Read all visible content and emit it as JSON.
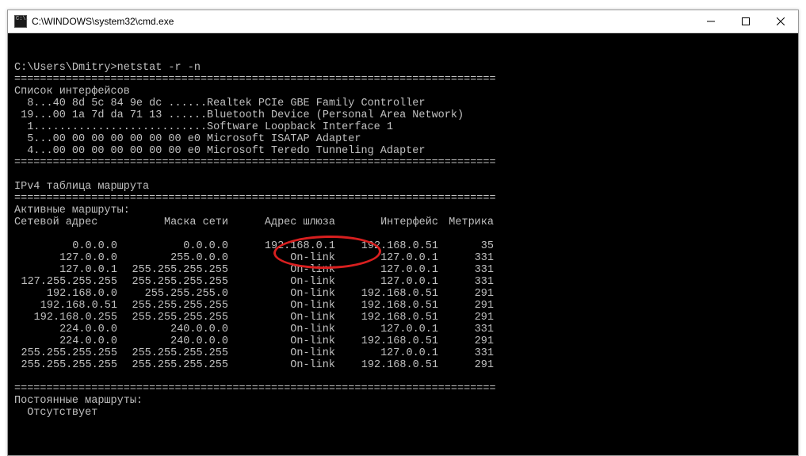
{
  "window": {
    "title": "C:\\WINDOWS\\system32\\cmd.exe",
    "icon_glyph": "C:\\."
  },
  "prompt": {
    "cwd": "C:\\Users\\Dmitry>",
    "command": "netstat -r -n"
  },
  "sections": {
    "if_header": "Список интерфейсов",
    "ipv4_header": "IPv4 таблица маршрута",
    "active_header": "Активные маршруты:",
    "col_net": "Сетевой адрес",
    "col_mask": "Маска сети",
    "col_gw": "Адрес шлюза",
    "col_if": "Интерфейс",
    "col_metric": "Метрика",
    "persist_header": "Постоянные маршруты:",
    "persist_none": "Отсутствует"
  },
  "interfaces": [
    "  8...40 8d 5c 84 9e dc ......Realtek PCIe GBE Family Controller",
    " 19...00 1a 7d da 71 13 ......Bluetooth Device (Personal Area Network)",
    "  1...........................Software Loopback Interface 1",
    "  5...00 00 00 00 00 00 00 e0 Microsoft ISATAP Adapter",
    "  4...00 00 00 00 00 00 00 e0 Microsoft Teredo Tunneling Adapter"
  ],
  "routes": [
    {
      "net": "0.0.0.0",
      "mask": "0.0.0.0",
      "gw": "192.168.0.1",
      "iface": "192.168.0.51",
      "metric": "35"
    },
    {
      "net": "127.0.0.0",
      "mask": "255.0.0.0",
      "gw": "On-link",
      "iface": "127.0.0.1",
      "metric": "331"
    },
    {
      "net": "127.0.0.1",
      "mask": "255.255.255.255",
      "gw": "On-link",
      "iface": "127.0.0.1",
      "metric": "331"
    },
    {
      "net": "127.255.255.255",
      "mask": "255.255.255.255",
      "gw": "On-link",
      "iface": "127.0.0.1",
      "metric": "331"
    },
    {
      "net": "192.168.0.0",
      "mask": "255.255.255.0",
      "gw": "On-link",
      "iface": "192.168.0.51",
      "metric": "291"
    },
    {
      "net": "192.168.0.51",
      "mask": "255.255.255.255",
      "gw": "On-link",
      "iface": "192.168.0.51",
      "metric": "291"
    },
    {
      "net": "192.168.0.255",
      "mask": "255.255.255.255",
      "gw": "On-link",
      "iface": "192.168.0.51",
      "metric": "291"
    },
    {
      "net": "224.0.0.0",
      "mask": "240.0.0.0",
      "gw": "On-link",
      "iface": "127.0.0.1",
      "metric": "331"
    },
    {
      "net": "224.0.0.0",
      "mask": "240.0.0.0",
      "gw": "On-link",
      "iface": "192.168.0.51",
      "metric": "291"
    },
    {
      "net": "255.255.255.255",
      "mask": "255.255.255.255",
      "gw": "On-link",
      "iface": "127.0.0.1",
      "metric": "331"
    },
    {
      "net": "255.255.255.255",
      "mask": "255.255.255.255",
      "gw": "On-link",
      "iface": "192.168.0.51",
      "metric": "291"
    }
  ],
  "rule_long": "===========================================================================",
  "blank": ""
}
